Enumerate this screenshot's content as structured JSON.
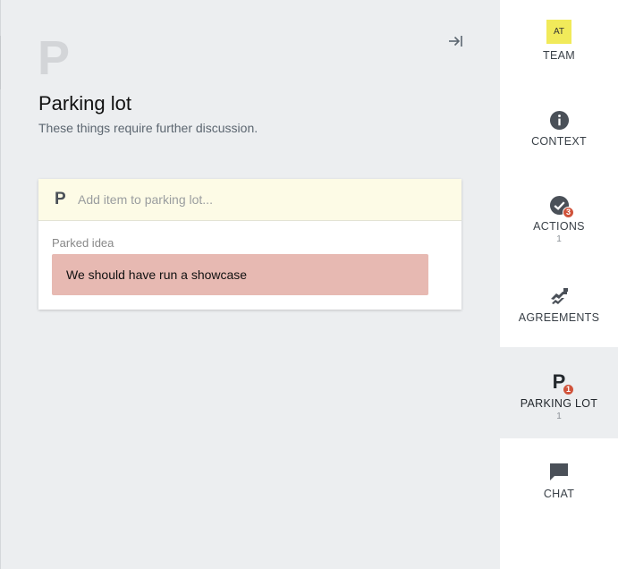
{
  "main": {
    "big_letter": "P",
    "title": "Parking lot",
    "subtitle": "These things require further discussion.",
    "add_icon_letter": "P",
    "add_placeholder": "Add item to parking lot...",
    "parked_label": "Parked idea",
    "parked_items": [
      {
        "text": "We should have run a showcase"
      }
    ]
  },
  "sidebar": {
    "team": {
      "avatar": "AT",
      "label": "TEAM",
      "icon": "avatar"
    },
    "context": {
      "label": "CONTEXT",
      "icon": "info-icon"
    },
    "actions": {
      "label": "ACTIONS",
      "badge": "3",
      "count": "1",
      "icon": "check-circle-icon"
    },
    "agreements": {
      "label": "AGREEMENTS",
      "icon": "handshake-icon"
    },
    "parking_lot": {
      "label": "PARKING LOT",
      "letter": "P",
      "badge": "1",
      "count": "1",
      "icon": "parking-icon"
    },
    "chat": {
      "label": "CHAT",
      "icon": "chat-bubble-icon"
    }
  },
  "colors": {
    "background": "#eceef0",
    "add_row_bg": "#fdfbe6",
    "parked_item_bg": "#e7b9b2",
    "avatar_bg": "#f1ea5a",
    "badge_bg": "#d0533b",
    "icon_dark": "#4a5058"
  }
}
